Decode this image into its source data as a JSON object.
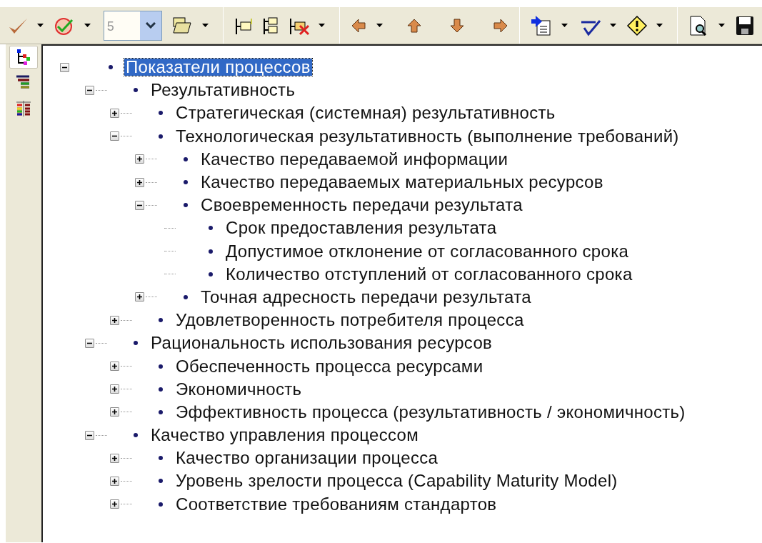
{
  "toolbar": {
    "level_combo": {
      "value": "5"
    }
  },
  "sidebar": {
    "views": [
      {
        "selected": true
      },
      {
        "selected": false
      },
      {
        "selected": false
      }
    ]
  },
  "tree": {
    "items": [
      {
        "label": "Показатели процессов",
        "selected": true,
        "expanded": true,
        "children": [
          {
            "label": "Результативность",
            "selected": false,
            "expanded": true,
            "children": [
              {
                "label": "Стратегическая (системная) результативность",
                "selected": false,
                "expanded": false
              },
              {
                "label": "Технологическая результативность (выполнение требований)",
                "selected": false,
                "expanded": true,
                "children": [
                  {
                    "label": "Качество передаваемой информации",
                    "selected": false,
                    "expanded": false
                  },
                  {
                    "label": "Качество передаваемых материальных ресурсов",
                    "selected": false,
                    "expanded": false
                  },
                  {
                    "label": "Своевременность передачи результата",
                    "selected": false,
                    "expanded": true,
                    "children": [
                      {
                        "label": "Срок предоставления результата",
                        "selected": false
                      },
                      {
                        "label": "Допустимое отклонение от согласованного срока",
                        "selected": false
                      },
                      {
                        "label": "Количество отступлений от согласованного срока",
                        "selected": false
                      }
                    ]
                  },
                  {
                    "label": "Точная адресность передачи результата",
                    "selected": false,
                    "expanded": false
                  }
                ]
              },
              {
                "label": "Удовлетворенность потребителя процесса",
                "selected": false,
                "expanded": false
              }
            ]
          },
          {
            "label": "Рациональность использования ресурсов",
            "selected": false,
            "expanded": true,
            "children": [
              {
                "label": "Обеспеченность процесса ресурсами",
                "selected": false,
                "expanded": false
              },
              {
                "label": "Экономичность",
                "selected": false,
                "expanded": false
              },
              {
                "label": "Эффективность процесса (результативность / экономичность)",
                "selected": false,
                "expanded": false
              }
            ]
          },
          {
            "label": "Качество управления процессом",
            "selected": false,
            "expanded": true,
            "children": [
              {
                "label": "Качество организации процесса",
                "selected": false,
                "expanded": false
              },
              {
                "label": "Уровень зрелости процесса (Capability Maturity Model)",
                "selected": false,
                "expanded": false
              },
              {
                "label": "Соответствие требованиям стандартов",
                "selected": false,
                "expanded": false
              }
            ]
          }
        ]
      }
    ]
  }
}
